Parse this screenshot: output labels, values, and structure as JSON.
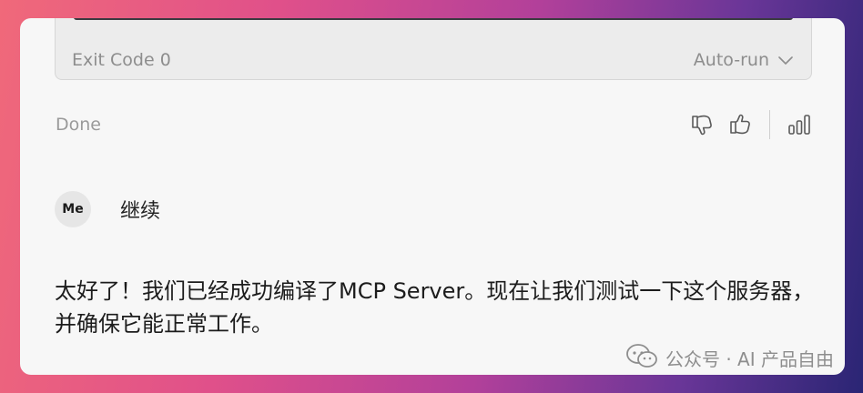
{
  "terminal": {
    "exit_code": "Exit Code 0",
    "autorun_label": "Auto-run"
  },
  "status": {
    "done": "Done"
  },
  "feedback": {
    "icons": [
      "thumbs-down-icon",
      "thumbs-up-icon",
      "signal-bars-icon"
    ]
  },
  "user": {
    "avatar_label": "Me",
    "message": "继续"
  },
  "assistant": {
    "message": "太好了！我们已经成功编译了MCP Server。现在让我们测试一下这个服务器，并确保它能正常工作。"
  },
  "watermark": {
    "text": "公众号 · AI 产品自由",
    "icon": "wechat-icon"
  },
  "colors": {
    "window_bg": "#f7f7f7",
    "card_bg": "#ececec",
    "muted_text": "#8d8d8d",
    "body_text": "#1c1c1c"
  }
}
